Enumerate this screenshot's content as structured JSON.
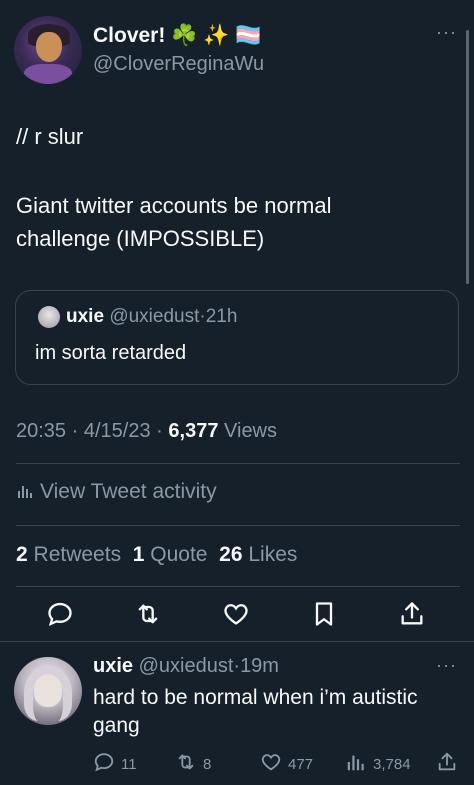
{
  "tweet": {
    "display_name": "Clover! ☘️ ✨ 🏳️‍⚧️",
    "handle": "@CloverReginaWu",
    "more": "···",
    "text_line1": "// r slur",
    "text_line2": "Giant twitter accounts be normal",
    "text_line3": "challenge (IMPOSSIBLE)",
    "quote": {
      "name": "uxie",
      "handle": "@uxiedust",
      "dot": "·",
      "time": "21h",
      "text": "im sorta retarded"
    },
    "time": "20:35",
    "dot": "·",
    "date": "4/15/23",
    "views_count": "6,377",
    "views_label": "Views",
    "activity_label": "View Tweet activity",
    "retweets_count": "2",
    "retweets_label": "Retweets",
    "quotes_count": "1",
    "quotes_label": "Quote",
    "likes_count": "26",
    "likes_label": "Likes"
  },
  "reply": {
    "name": "uxie",
    "handle": "@uxiedust",
    "dot": "·",
    "time": "19m",
    "more": "···",
    "text": "hard to be normal when i’m autistic gang",
    "replies": "11",
    "retweets": "8",
    "likes": "477",
    "views": "3,784"
  },
  "icons": [
    "reply-icon",
    "retweet-icon",
    "like-icon",
    "bookmark-icon",
    "share-icon",
    "views-icon",
    "activity-icon"
  ],
  "colors": {
    "background": "#15202b",
    "text": "#f7f9f9",
    "muted": "#8b98a5",
    "border": "#38444d"
  }
}
